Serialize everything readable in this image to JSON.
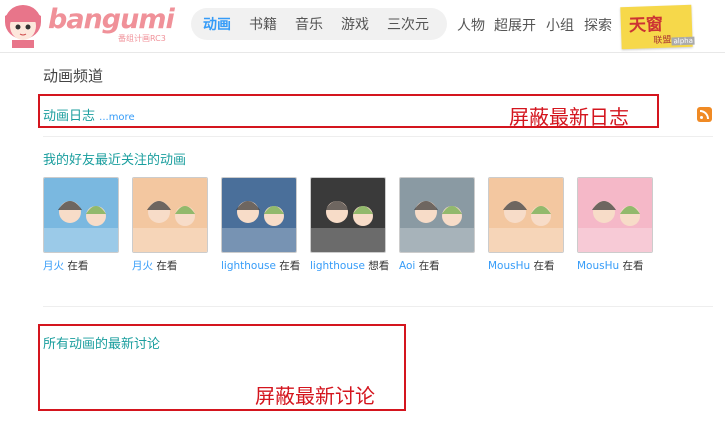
{
  "header": {
    "logo_text": "bangumi",
    "logo_sub": "番组计画RC3",
    "nav_primary": [
      {
        "label": "动画",
        "active": true
      },
      {
        "label": "书籍",
        "active": false
      },
      {
        "label": "音乐",
        "active": false
      },
      {
        "label": "游戏",
        "active": false
      },
      {
        "label": "三次元",
        "active": false
      }
    ],
    "nav_secondary": [
      "人物",
      "超展开",
      "小组",
      "探索"
    ],
    "promo": {
      "title": "天窗",
      "sub": "联盟",
      "tag": "alpha"
    }
  },
  "page_title": "动画频道",
  "anime_log": {
    "title": "动画日志",
    "more": "...more",
    "overlay_label": "屏蔽最新日志"
  },
  "friends_section": {
    "title": "我的好友最近关注的动画"
  },
  "friends": [
    {
      "user": "月火",
      "status": "在看",
      "color": "#7ab8e0"
    },
    {
      "user": "月火",
      "status": "在看",
      "color": "#f3c7a0"
    },
    {
      "user": "lighthouse",
      "status": "在看",
      "color": "#4a6f9a"
    },
    {
      "user": "lighthouse",
      "status": "想看",
      "color": "#3a3a3a"
    },
    {
      "user": "Aoi",
      "status": "在看",
      "color": "#8a9aa3"
    },
    {
      "user": "MousHu",
      "status": "在看",
      "color": "#f3c7a0"
    },
    {
      "user": "MousHu",
      "status": "在看",
      "color": "#f5b8c8"
    }
  ],
  "discussions": {
    "title": "所有动画的最新讨论",
    "overlay_label": "屏蔽最新讨论"
  }
}
